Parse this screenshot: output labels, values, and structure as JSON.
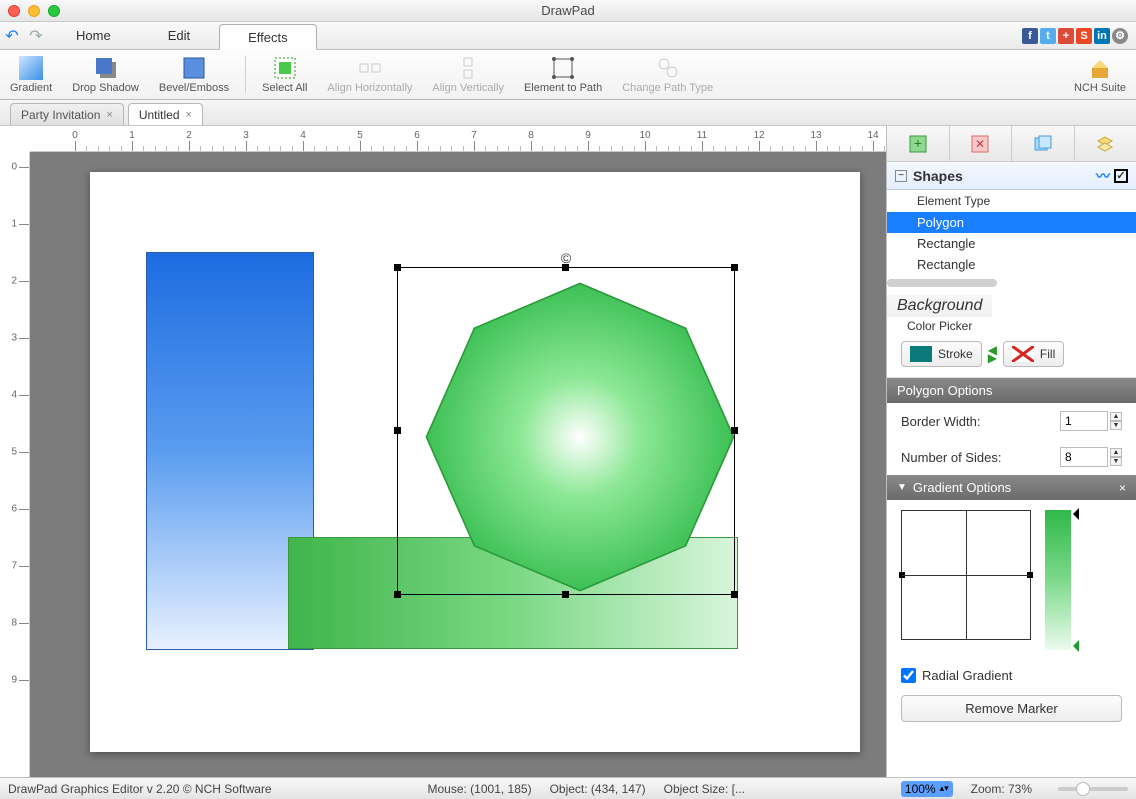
{
  "window": {
    "title": "DrawPad"
  },
  "menu": {
    "tabs": [
      "Home",
      "Edit",
      "Effects"
    ],
    "active": 2
  },
  "ribbon": {
    "items": [
      {
        "label": "Gradient",
        "enabled": true
      },
      {
        "label": "Drop Shadow",
        "enabled": true
      },
      {
        "label": "Bevel/Emboss",
        "enabled": true
      },
      {
        "label": "Select All",
        "enabled": true
      },
      {
        "label": "Align Horizontally",
        "enabled": false
      },
      {
        "label": "Align Vertically",
        "enabled": false
      },
      {
        "label": "Element to Path",
        "enabled": true
      },
      {
        "label": "Change Path Type",
        "enabled": false
      }
    ],
    "suite_label": "NCH Suite"
  },
  "doctabs": [
    {
      "label": "Party Invitation",
      "active": false
    },
    {
      "label": "Untitled",
      "active": true
    }
  ],
  "shapes_panel": {
    "title": "Shapes",
    "column": "Element Type",
    "items": [
      "Polygon",
      "Rectangle",
      "Rectangle"
    ],
    "selected": 0
  },
  "background": {
    "header": "Background",
    "label": "Color Picker",
    "stroke_label": "Stroke",
    "fill_label": "Fill",
    "stroke_color": "#0b7a7a"
  },
  "polygon_options": {
    "header": "Polygon Options",
    "border_width_label": "Border Width:",
    "border_width": "1",
    "sides_label": "Number of Sides:",
    "sides": "8"
  },
  "gradient_options": {
    "header": "Gradient Options",
    "radial_label": "Radial Gradient",
    "radial_checked": true,
    "remove_label": "Remove Marker"
  },
  "status": {
    "app": "DrawPad Graphics Editor v 2.20 © NCH Software",
    "mouse": "Mouse: (1001, 185)",
    "object": "Object: (434, 147)",
    "object_size": "Object Size: [...",
    "zoom_select": "100%",
    "zoom_label": "Zoom: 73%"
  },
  "ruler_h": [
    0,
    1,
    2,
    3,
    4,
    5,
    6,
    7,
    8,
    9,
    10,
    11,
    12,
    13,
    14
  ],
  "ruler_v": [
    0,
    1,
    2,
    3,
    4,
    5,
    6,
    7,
    8,
    9
  ]
}
